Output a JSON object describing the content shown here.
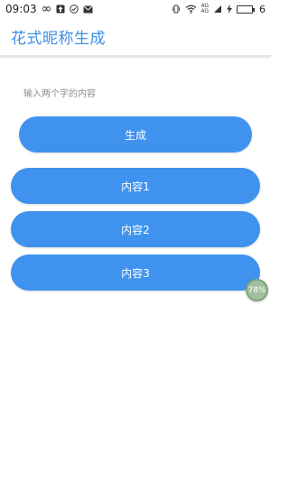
{
  "status_bar": {
    "time": "09:03",
    "loop_symbol": "∞",
    "icons": [
      "infinity-icon",
      "upload-icon",
      "check-circle-icon",
      "mail-icon",
      "vibrate-icon",
      "wifi-icon",
      "cellular-icon",
      "charging-icon",
      "battery-icon"
    ],
    "network_top": "4G",
    "network_bottom": "4G",
    "battery_level": "6"
  },
  "app_bar": {
    "title": "花式昵称生成"
  },
  "main": {
    "hint": "输入两个字的内容",
    "generate_label": "生成",
    "results": [
      "内容1",
      "内容2",
      "内容3"
    ]
  },
  "floating_badge": {
    "text": "78%"
  },
  "colors": {
    "accent": "#3f93ee",
    "title": "#3d8fe8"
  }
}
